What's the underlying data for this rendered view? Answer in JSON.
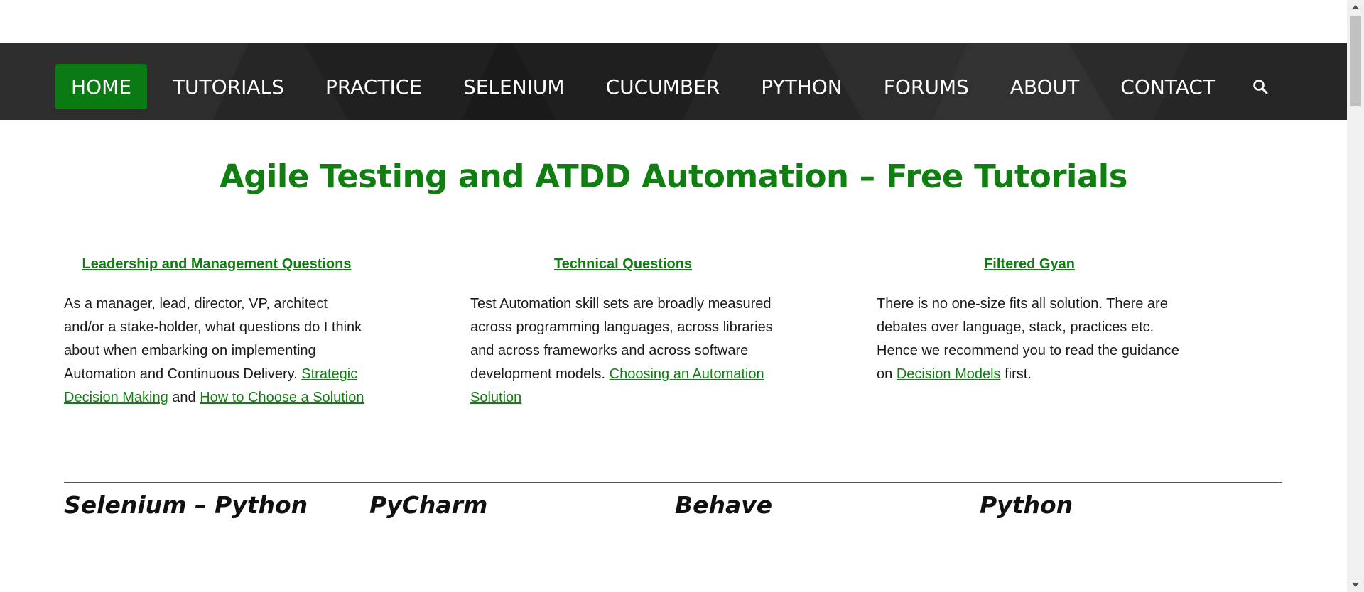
{
  "nav": {
    "items": [
      {
        "label": "HOME",
        "active": true
      },
      {
        "label": "TUTORIALS"
      },
      {
        "label": "PRACTICE"
      },
      {
        "label": "SELENIUM"
      },
      {
        "label": "CUCUMBER"
      },
      {
        "label": "PYTHON"
      },
      {
        "label": "FORUMS"
      },
      {
        "label": "ABOUT"
      },
      {
        "label": "CONTACT"
      }
    ],
    "search_icon": "search-icon"
  },
  "headline": "Agile Testing and ATDD Automation –  Free Tutorials",
  "columns": [
    {
      "title": "Leadership and Management Questions",
      "text": "As a manager, lead, director, VP, architect and/or a stake-holder, what questions do I think about when embarking on implementing Automation and Continuous Delivery.",
      "link1": "Strategic Decision Making",
      "joiner": " and ",
      "link2": "How to Choose a Solution"
    },
    {
      "title": "Technical Questions",
      "text": "Test Automation skill sets are broadly measured across programming languages, across libraries and across frameworks and across software development models.",
      "link1": "Choosing an Automation Solution"
    },
    {
      "title": "Filtered Gyan",
      "text_before": "There is no one-size fits all solution. There are debates over language, stack, practices etc. Hence we recommend you to read the guidance on ",
      "link1": "Decision Models",
      "text_after": " first."
    }
  ],
  "categories": [
    "Selenium – Python",
    "PyCharm",
    "Behave",
    "Python"
  ],
  "colors": {
    "accent_green": "#117e12",
    "nav_active": "#0a7a12",
    "nav_bg": "#262626"
  }
}
